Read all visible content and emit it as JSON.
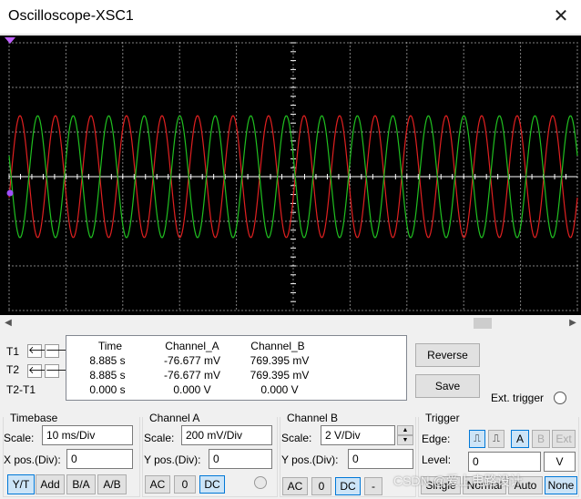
{
  "window": {
    "title": "Oscilloscope-XSC1",
    "close_glyph": "✕"
  },
  "scope": {
    "channel_a_color": "#e02020",
    "channel_b_color": "#20c020",
    "grid_color": "#ffffff",
    "background": "#000000",
    "cycles_visible": 16
  },
  "cursors": {
    "t1_label": "T1",
    "t2_label": "T2",
    "diff_label": "T2-T1"
  },
  "readout": {
    "headers": [
      "Time",
      "Channel_A",
      "Channel_B"
    ],
    "rows": [
      [
        "8.885 s",
        "-76.677 mV",
        "769.395 mV"
      ],
      [
        "8.885 s",
        "-76.677 mV",
        "769.395 mV"
      ],
      [
        "0.000 s",
        "0.000 V",
        "0.000 V"
      ]
    ]
  },
  "actions": {
    "reverse": "Reverse",
    "save": "Save",
    "ext_trigger": "Ext. trigger"
  },
  "timebase": {
    "title": "Timebase",
    "scale_label": "Scale:",
    "scale_value": "10 ms/Div",
    "xpos_label": "X pos.(Div):",
    "xpos_value": "0",
    "modes": [
      "Y/T",
      "Add",
      "B/A",
      "A/B"
    ]
  },
  "channel_a": {
    "title": "Channel A",
    "scale_label": "Scale:",
    "scale_value": "200 mV/Div",
    "ypos_label": "Y pos.(Div):",
    "ypos_value": "0",
    "coupling": [
      "AC",
      "0",
      "DC"
    ]
  },
  "channel_b": {
    "title": "Channel B",
    "scale_label": "Scale:",
    "scale_value": "2  V/Div",
    "ypos_label": "Y pos.(Div):",
    "ypos_value": "0",
    "coupling": [
      "AC",
      "0",
      "DC",
      "-"
    ]
  },
  "trigger": {
    "title": "Trigger",
    "edge_label": "Edge:",
    "level_label": "Level:",
    "level_value": "0",
    "level_unit": "V",
    "sources": [
      "A",
      "B",
      "Ext"
    ],
    "modes": [
      "Single",
      "Normal",
      "Auto",
      "None"
    ]
  },
  "watermark": "CSDN @爱上电路设计"
}
